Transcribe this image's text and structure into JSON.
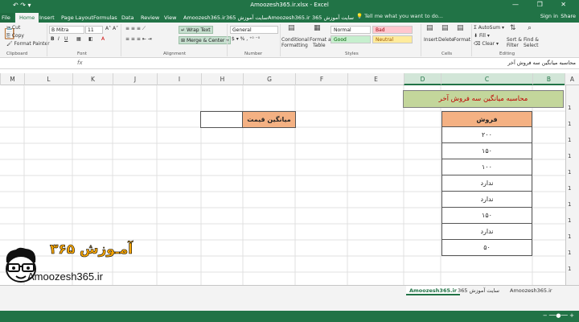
{
  "window": {
    "title": "Amoozesh365.ir.xlsx - Excel",
    "controls": [
      "—",
      "❐",
      "✕"
    ]
  },
  "tabs": {
    "file": "File",
    "items": [
      "Home",
      "Insert",
      "Page Layout",
      "Formulas",
      "Data",
      "Review",
      "View",
      "Amoozesh365.ir",
      "سایت آموزش 365",
      "Amoozesh365.ir",
      "سایت آموزش 365"
    ],
    "tell_me": "Tell me what you want to do...",
    "sign_in": "Sign in",
    "share": "Share"
  },
  "ribbon": {
    "clipboard": {
      "label": "Clipboard",
      "cut": "Cut",
      "copy": "Copy",
      "format_painter": "Format Painter"
    },
    "font": {
      "label": "Font",
      "name": "B Mitra",
      "size": "11"
    },
    "alignment": {
      "label": "Alignment",
      "wrap_text": "Wrap Text",
      "merge_center": "Merge & Center"
    },
    "number": {
      "label": "Number",
      "format": "General"
    },
    "styles": {
      "label": "Styles",
      "conditional": "Conditional",
      "conditional2": "Formatting",
      "format_as": "Format as",
      "format_as2": "Table",
      "normal": "Normal",
      "bad": "Bad",
      "good": "Good",
      "neutral": "Neutral"
    },
    "cells": {
      "label": "Cells",
      "insert": "Insert",
      "delete": "Delete",
      "format": "Format"
    },
    "editing": {
      "label": "Editing",
      "autosum": "AutoSum",
      "fill": "Fill",
      "clear": "Clear",
      "sort": "Sort &",
      "sort2": "Filter",
      "find": "Find &",
      "find2": "Select"
    }
  },
  "formula_bar": {
    "fx": "fx",
    "content": "محاسبه میانگین سه فروش آخر"
  },
  "columns": [
    "A",
    "B",
    "C",
    "D",
    "E",
    "F",
    "G",
    "H",
    "I",
    "J",
    "K",
    "L",
    "M"
  ],
  "rows": [
    "1",
    "1",
    "1",
    "1",
    "1",
    "1",
    "1",
    "1",
    "1",
    "1",
    "1",
    "1",
    "1"
  ],
  "sheet": {
    "banner": "محاسبه میانگین سه فروش آخر",
    "table_header": "فروش",
    "sales": [
      "۲۰۰",
      "۱۵۰",
      "۱۰۰",
      "ندارد",
      "ندارد",
      "۱۵۰",
      "ندارد",
      "۵۰"
    ],
    "avg_label": "میانگین قیمت"
  },
  "logo": {
    "brand": "آمـوزش ۳۶۵",
    "site": "Amoozesh365.ir"
  },
  "sheet_tabs": [
    "Amoozesh365.ir",
    "سایت آموزش 365",
    "Amoozesh365.ir"
  ],
  "colors": {
    "excel_green": "#217346",
    "banner_green": "#c3d69b",
    "header_orange": "#f4b183",
    "banner_text": "#c00000"
  }
}
